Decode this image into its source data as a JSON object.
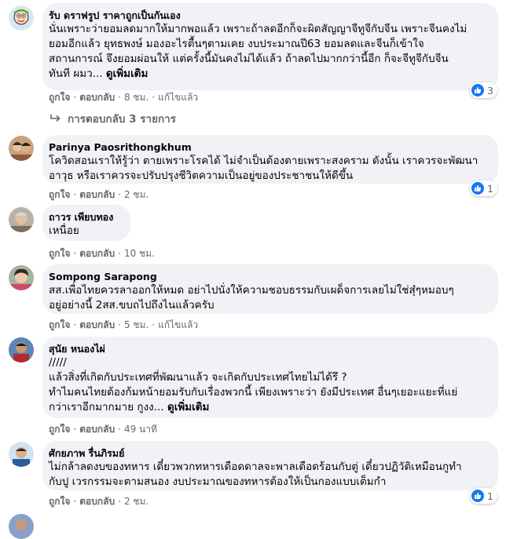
{
  "comments": [
    {
      "author": "รับ ดราฟรูป ราคาถูกเป็นกันเอง",
      "lines": [
        "นั่นเพราะว่ายอมลดมากให้มากพอแล้ว เพราะถ้าลดอีกก็จะผิดสัญญาจีทูจีกับจีน เพราะจีนคงไม่",
        "ยอมอีกแล้ว ยุทธพงษ์ มองอะไรตื้นๆตามเคย งบประมาณปี63 ยอมลดและจีนก็เข้าใจ",
        "สถานการณ์ จึงยอมผ่อนให้ แต่ครั้งนี้มันคงไม่ได้แล้ว ถ้าลดไปมากกว่านี้อีก ก็จะจีทูจีกับจีน"
      ],
      "last_line": "ทันที ผมว...",
      "see_more": "ดูเพิ่มเติม",
      "like_label": "ถูกใจ",
      "reply_label": "ตอบกลับ",
      "time": "8 ชม.",
      "edited": "แก้ไขแล้ว",
      "reaction_count": "3",
      "replies_label": "การตอบกลับ 3 รายการ"
    },
    {
      "author": "Parinya Paosrithongkhum",
      "lines": [
        "โควิดสอนเราให้รู้ว่า ตายเพราะโรคได้ ไม่จำเป็นต้องตายเพราะสงคราม ดังนั้น เราควรจะพัฒนา",
        "อาวุธ หรือเราควรจะปรับปรุงชีวิตความเป็นอยู่ของประชาชนให้ดีขึ้น"
      ],
      "like_label": "ถูกใจ",
      "reply_label": "ตอบกลับ",
      "time": "2 ชม.",
      "reaction_count": "1"
    },
    {
      "author": "ถาวร เพียบทอง",
      "lines": [
        "เหนื่อย"
      ],
      "like_label": "ถูกใจ",
      "reply_label": "ตอบกลับ",
      "time": "10 ชม."
    },
    {
      "author": "Sompong Sarapong",
      "lines": [
        "สส.เพื่อไทยควรลาออกให้หมด อย่าไปนั่งให้ความชอบธรรมกับเผด็จการเลยไม่ใช่สุ๋ๆหมอบๆ",
        "อยู่อย่างนี้ 2สส.ขบถไปถึงไนแล้วครับ"
      ],
      "like_label": "ถูกใจ",
      "reply_label": "ตอบกลับ",
      "time": "5 ชม.",
      "edited": "แก้ไขแล้ว"
    },
    {
      "author": "สุนัย หนองไผ่",
      "lines": [
        "/////",
        "แล้วสิ่งที่เกิดกับประเทศที่พัฒนาแล้ว จะเกิดกับประเทศไทยไม่ได้รึ ?",
        "ทำไมคนไทยต้องก้มหน้ายอมรับกับเรื่องพวกนี้ เพียงเพราะว่า ยังมีประเทศ อื่นๆเยอะแยะที่แย่"
      ],
      "last_line": "กว่าเราอีกมากมาย กูงง...",
      "see_more": "ดูเพิ่มเติม",
      "like_label": "ถูกใจ",
      "reply_label": "ตอบกลับ",
      "time": "49 นาที"
    },
    {
      "author": "ศักยภาพ รื่นภิรมย์",
      "lines": [
        "ไม่กล้าลดงบของทหาร เดี๋ยวพวกทหารเดือดดาลจะพาลเดือดร้อนกับตู่ เดี๋ยวปฏิวัติเหมือนกูทำ",
        "กับปู เวรกรรมจะตามสนอง งบประมาณของทหารต้องให้เป็นกองแบบเต็มกำ"
      ],
      "like_label": "ถูกใจ",
      "reply_label": "ตอบกลับ",
      "time": "2 ชม.",
      "reaction_count": "1"
    }
  ],
  "colors": {
    "bubble": "#f0f2f5",
    "meta_text": "#65676b",
    "like_blue": "#1877f2",
    "text": "#050505"
  },
  "icons": {
    "like": "thumbs-up-icon",
    "reply_arrow": "reply-arrow-icon"
  }
}
